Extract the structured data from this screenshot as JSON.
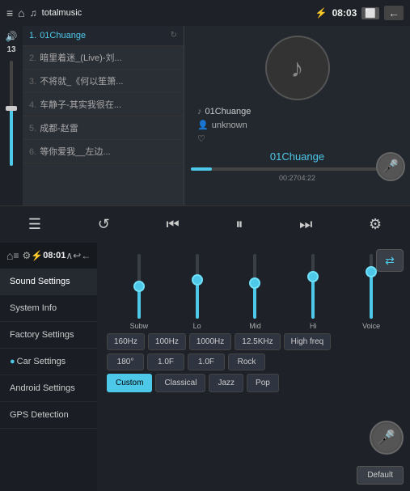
{
  "topBar": {
    "iconLeft": "≡",
    "appIcon": "♫",
    "appName": "totalmusic",
    "bluetooth": "⚡",
    "time": "08:03",
    "batteryArea": "08:0",
    "backIcon": "←"
  },
  "playlist": {
    "items": [
      {
        "num": "1.",
        "title": "01Chuange",
        "active": true
      },
      {
        "num": "2.",
        "title": "暗里着迷_(Live)-刘...",
        "active": false
      },
      {
        "num": "3.",
        "title": "不将就_《何以笙箫...",
        "active": false
      },
      {
        "num": "4.",
        "title": "车静子-其实我很在...",
        "active": false
      },
      {
        "num": "5.",
        "title": "成都-赵雷",
        "active": false
      },
      {
        "num": "6.",
        "title": "等你爱我__左边...",
        "active": false
      }
    ]
  },
  "volume": {
    "icon": "🔊",
    "level": 13,
    "fillPercent": 55,
    "thumbPositionPercent": 55
  },
  "nowPlaying": {
    "trackTitle": "01Chuange",
    "artist": "unknown",
    "trackNameLarge": "01Chuange",
    "timeElapsed": "00:27",
    "timeTotal": "04:22",
    "progressPercent": 10
  },
  "controls": {
    "playlist": "☰",
    "repeat": "↺",
    "prev": "⏮",
    "playPause": "⏸",
    "next": "⏭",
    "eq": "⚙"
  },
  "settingsBar": {
    "homeIcon": "⌂",
    "icons": [
      "≡",
      "⚙"
    ],
    "bluetooth": "⚡",
    "time": "08:01",
    "upIcon": "∧",
    "backIcon": "↩",
    "returnIcon": "←"
  },
  "sidebar": {
    "items": [
      {
        "label": "Sound Settings",
        "active": true
      },
      {
        "label": "System Info",
        "active": false
      },
      {
        "label": "Factory Settings",
        "active": false
      },
      {
        "label": "Car Settings",
        "active": false
      },
      {
        "label": "Android Settings",
        "active": false
      },
      {
        "label": "GPS Detection",
        "active": false
      }
    ]
  },
  "eq": {
    "soundIconLabel": "🔊",
    "sliders": [
      {
        "label": "Subw",
        "fillPercent": 50,
        "thumbPercent": 50
      },
      {
        "label": "Lo",
        "fillPercent": 60,
        "thumbPercent": 60
      },
      {
        "label": "Mid",
        "fillPercent": 55,
        "thumbPercent": 55
      },
      {
        "label": "Hi",
        "fillPercent": 65,
        "thumbPercent": 65
      },
      {
        "label": "Voice",
        "fillPercent": 72,
        "thumbPercent": 72
      }
    ],
    "freqButtons": [
      "160Hz",
      "100Hz",
      "1000Hz",
      "12.5KHz",
      "High freq"
    ],
    "valueButtons": [
      "180°",
      "1.0F",
      "1.0F",
      "Rock"
    ],
    "presetButtons": [
      {
        "label": "Custom",
        "active": true
      },
      {
        "label": "Classical",
        "active": false
      },
      {
        "label": "Jazz",
        "active": false
      },
      {
        "label": "Pop",
        "active": false
      }
    ],
    "defaultButton": "Default"
  }
}
